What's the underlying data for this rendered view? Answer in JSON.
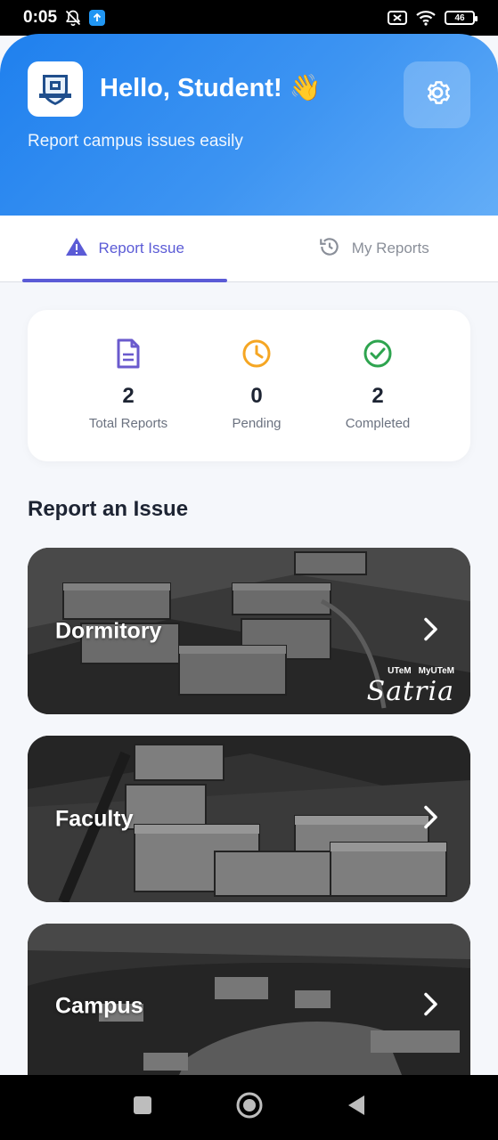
{
  "status_bar": {
    "time": "0:05",
    "battery": "46"
  },
  "header": {
    "greeting": "Hello, Student!",
    "emoji": "👋",
    "subtitle": "Report campus issues easily"
  },
  "tabs": [
    {
      "label": "Report Issue",
      "icon": "warning-icon",
      "active": true
    },
    {
      "label": "My Reports",
      "icon": "history-icon",
      "active": false
    }
  ],
  "stats": [
    {
      "value": "2",
      "label": "Total Reports",
      "icon": "document-icon",
      "color": "#6a5acd"
    },
    {
      "value": "0",
      "label": "Pending",
      "icon": "clock-icon",
      "color": "#f5a623"
    },
    {
      "value": "2",
      "label": "Completed",
      "icon": "check-circle-icon",
      "color": "#2ea44f"
    }
  ],
  "section_title": "Report an Issue",
  "categories": [
    {
      "label": "Dormitory"
    },
    {
      "label": "Faculty"
    },
    {
      "label": "Campus"
    }
  ],
  "watermark": {
    "brand": "UTeM",
    "handle": "MyUTeM",
    "script": "Satria"
  },
  "colors": {
    "accent": "#5b5bd6",
    "header_start": "#1f80ee",
    "header_end": "#63adf7"
  }
}
